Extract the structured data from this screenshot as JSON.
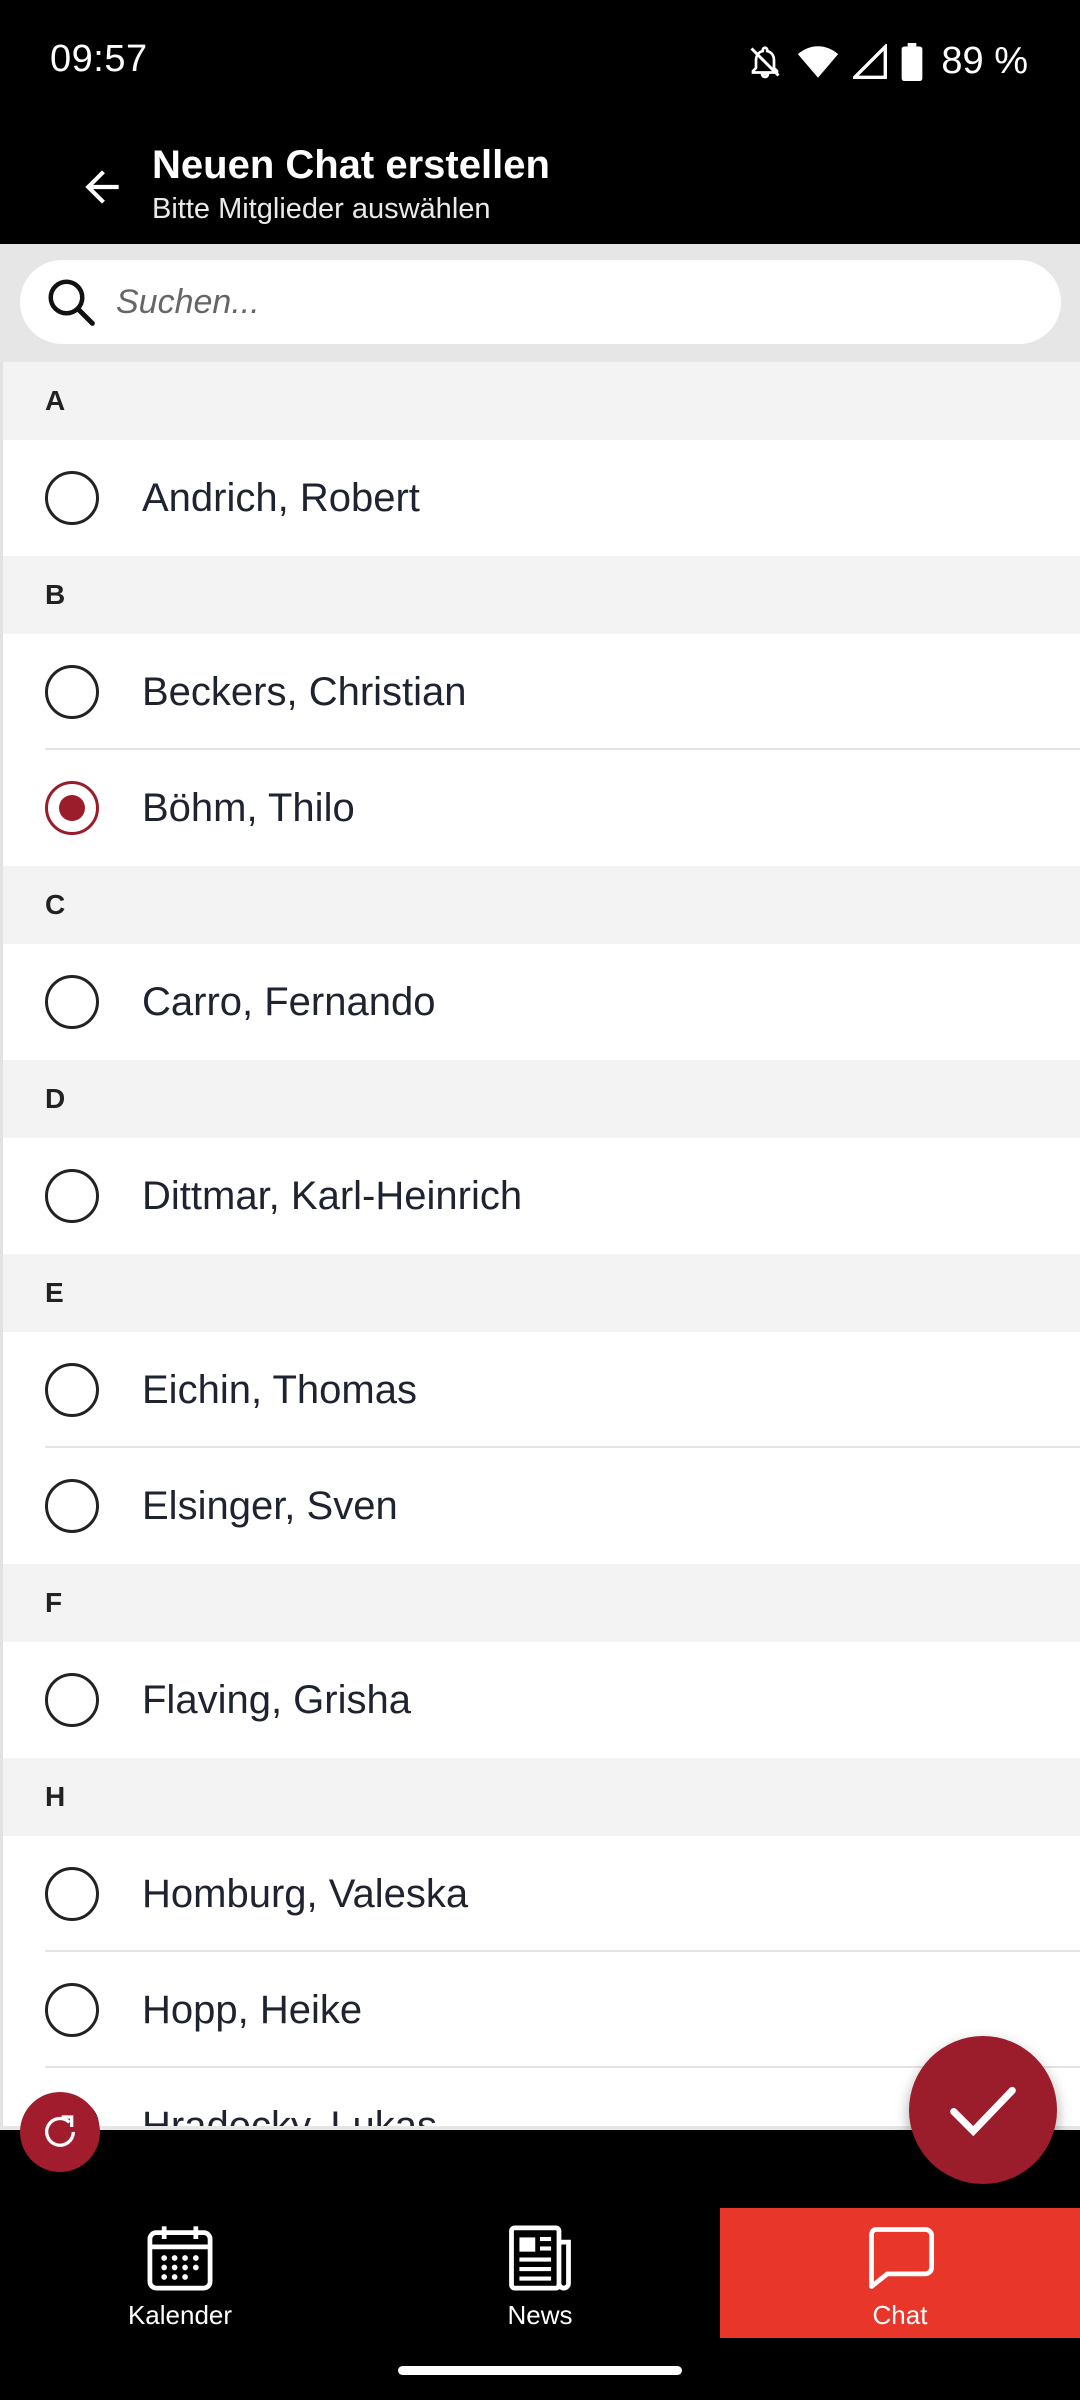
{
  "status_bar": {
    "time": "09:57",
    "battery": "89 %"
  },
  "app_bar": {
    "title": "Neuen Chat erstellen",
    "subtitle": "Bitte Mitglieder auswählen"
  },
  "search": {
    "placeholder": "Suchen..."
  },
  "contacts": {
    "sections": [
      {
        "letter": "A",
        "members": [
          {
            "name": "Andrich, Robert",
            "selected": false
          }
        ]
      },
      {
        "letter": "B",
        "members": [
          {
            "name": "Beckers, Christian",
            "selected": false
          },
          {
            "name": "Böhm, Thilo",
            "selected": true
          }
        ]
      },
      {
        "letter": "C",
        "members": [
          {
            "name": "Carro, Fernando",
            "selected": false
          }
        ]
      },
      {
        "letter": "D",
        "members": [
          {
            "name": "Dittmar, Karl-Heinrich",
            "selected": false
          }
        ]
      },
      {
        "letter": "E",
        "members": [
          {
            "name": "Eichin, Thomas",
            "selected": false
          },
          {
            "name": "Elsinger, Sven",
            "selected": false
          }
        ]
      },
      {
        "letter": "F",
        "members": [
          {
            "name": "Flaving, Grisha",
            "selected": false
          }
        ]
      },
      {
        "letter": "H",
        "members": [
          {
            "name": "Homburg, Valeska",
            "selected": false
          },
          {
            "name": "Hopp, Heike",
            "selected": false
          },
          {
            "name": "Hradecky, Lukas",
            "selected": false
          }
        ]
      }
    ]
  },
  "bottom_nav": {
    "items": [
      {
        "label": "Kalender",
        "icon": "calendar-icon",
        "active": false
      },
      {
        "label": "News",
        "icon": "newspaper-icon",
        "active": false
      },
      {
        "label": "Chat",
        "icon": "chat-bubble-icon",
        "active": true
      }
    ]
  },
  "colors": {
    "accent": "#9b1c2a",
    "active_nav": "#e8372a"
  }
}
